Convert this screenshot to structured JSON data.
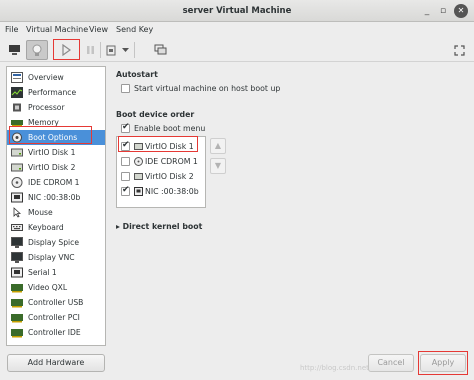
{
  "window": {
    "title": "server Virtual Machine"
  },
  "menubar": {
    "items": [
      "File",
      "Virtual Machine",
      "View",
      "Send Key"
    ]
  },
  "toolbar": {
    "buttons": [
      "monitor-icon",
      "lightbulb-icon",
      "play-icon",
      "pause-icon",
      "power-icon",
      "power-dropdown-icon",
      "snapshot-icon",
      "fullscreen-icon"
    ]
  },
  "sidebar": {
    "items": [
      {
        "label": "Overview",
        "icon": "overview-icon"
      },
      {
        "label": "Performance",
        "icon": "performance-icon"
      },
      {
        "label": "Processor",
        "icon": "processor-icon"
      },
      {
        "label": "Memory",
        "icon": "memory-icon"
      },
      {
        "label": "Boot Options",
        "icon": "boot-options-icon",
        "selected": true
      },
      {
        "label": "VirtIO Disk 1",
        "icon": "disk-icon"
      },
      {
        "label": "VirtIO Disk 2",
        "icon": "disk-icon"
      },
      {
        "label": "IDE CDROM 1",
        "icon": "cdrom-icon"
      },
      {
        "label": "NIC :00:38:0b",
        "icon": "nic-icon"
      },
      {
        "label": "Mouse",
        "icon": "mouse-icon"
      },
      {
        "label": "Keyboard",
        "icon": "keyboard-icon"
      },
      {
        "label": "Display Spice",
        "icon": "display-icon"
      },
      {
        "label": "Display VNC",
        "icon": "display-icon"
      },
      {
        "label": "Serial 1",
        "icon": "serial-icon"
      },
      {
        "label": "Video QXL",
        "icon": "video-icon"
      },
      {
        "label": "Controller USB",
        "icon": "controller-icon"
      },
      {
        "label": "Controller PCI",
        "icon": "controller-icon"
      },
      {
        "label": "Controller IDE",
        "icon": "controller-icon"
      }
    ],
    "add_hardware_label": "Add Hardware"
  },
  "autostart": {
    "title": "Autostart",
    "start_on_boot_label": "Start virtual machine on host boot up",
    "start_on_boot_checked": false
  },
  "boot_order": {
    "title": "Boot device order",
    "enable_menu_label": "Enable boot menu",
    "enable_menu_checked": true,
    "devices": [
      {
        "label": "VirtIO Disk 1",
        "checked": true,
        "icon": "disk-icon"
      },
      {
        "label": "IDE CDROM 1",
        "checked": false,
        "icon": "cdrom-icon"
      },
      {
        "label": "VirtIO Disk 2",
        "checked": false,
        "icon": "disk-icon"
      },
      {
        "label": "NIC :00:38:0b",
        "checked": true,
        "icon": "nic-icon"
      }
    ],
    "up_arrow": "up-arrow-icon",
    "down_arrow": "down-arrow-icon"
  },
  "direct_kernel_boot": {
    "label": "Direct kernel boot"
  },
  "actions": {
    "cancel_label": "Cancel",
    "apply_label": "Apply"
  },
  "watermark": {
    "text": "http://blog.csdn.net/..."
  },
  "colors": {
    "selection": "#4a90d9",
    "highlight_box": "#e53935"
  }
}
